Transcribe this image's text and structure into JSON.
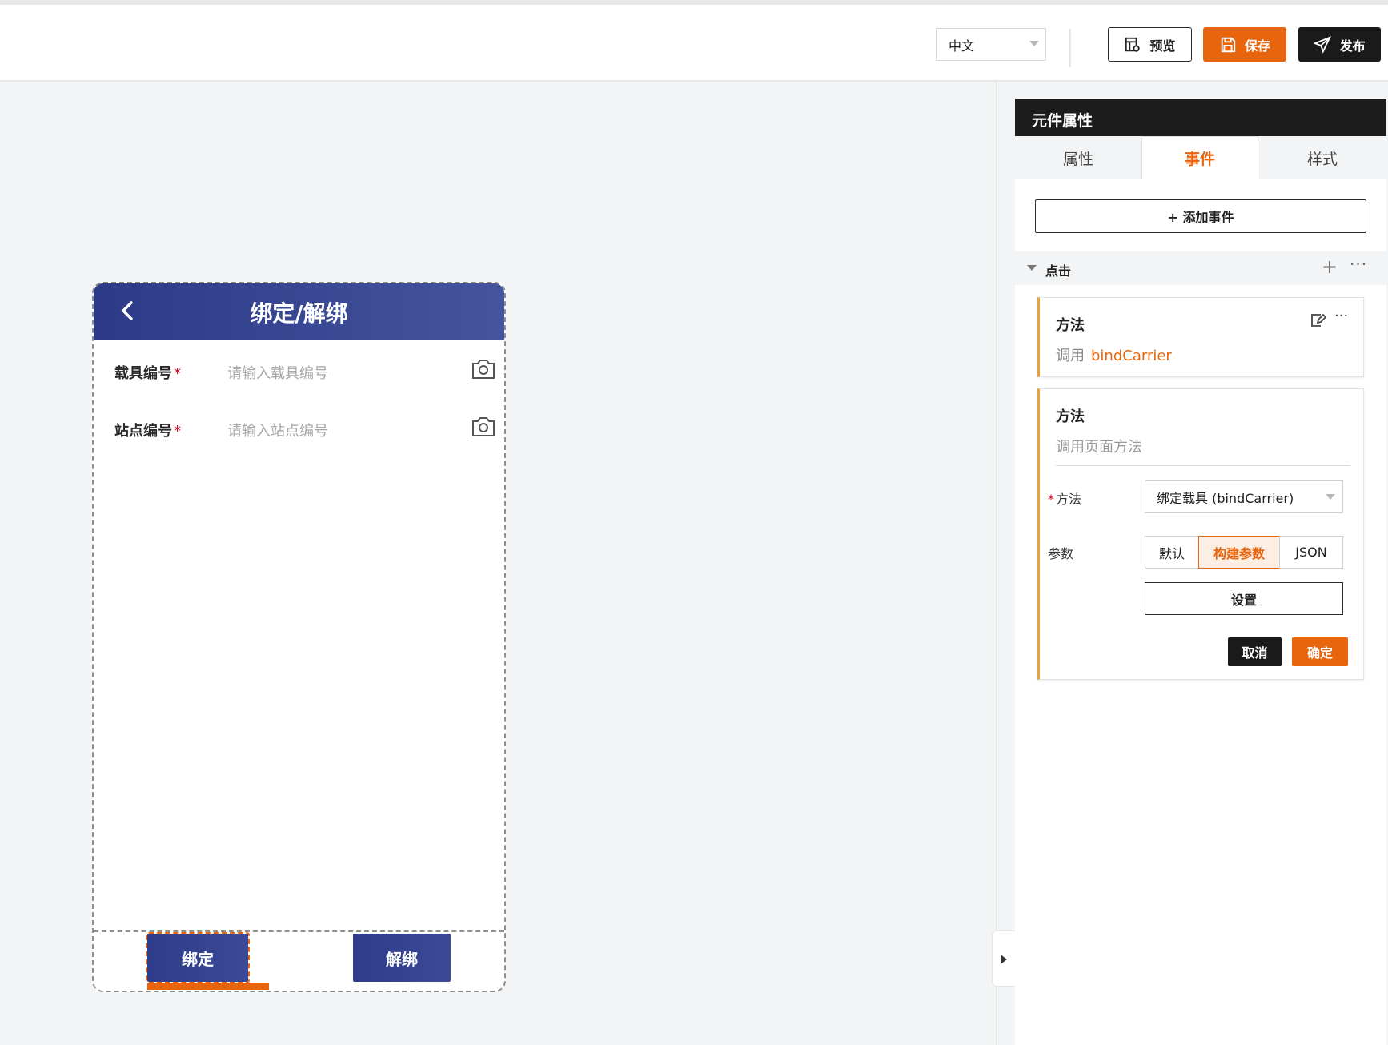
{
  "toolbar": {
    "language": "中文",
    "preview_label": "预览",
    "save_label": "保存",
    "publish_label": "发布"
  },
  "phone": {
    "title": "绑定/解绑",
    "fields": [
      {
        "label": "载具编号",
        "required_mark": "*",
        "placeholder": "请输入载具编号"
      },
      {
        "label": "站点编号",
        "required_mark": "*",
        "placeholder": "请输入站点编号"
      }
    ],
    "bind_button": "绑定",
    "unbind_button": "解绑"
  },
  "panel": {
    "header": "元件属性",
    "tabs": [
      "属性",
      "事件",
      "样式"
    ],
    "active_tab": "事件",
    "add_event": "+ 添加事件",
    "event_group": "点击",
    "card1": {
      "title": "方法",
      "call_prefix": "调用",
      "method_name": "bindCarrier"
    },
    "card2": {
      "title": "方法",
      "subtitle": "调用页面方法",
      "method_label": "方法",
      "method_required": "*",
      "method_value": "绑定载具 (bindCarrier)",
      "params_label": "参数",
      "param_options": [
        "默认",
        "构建参数",
        "JSON"
      ],
      "selected_param": "构建参数",
      "settings_button": "设置",
      "cancel_button": "取消",
      "confirm_button": "确定"
    }
  },
  "colors": {
    "accent": "#e8650e",
    "phone_header": "#2c3a88",
    "dark": "#1a1a1a"
  }
}
